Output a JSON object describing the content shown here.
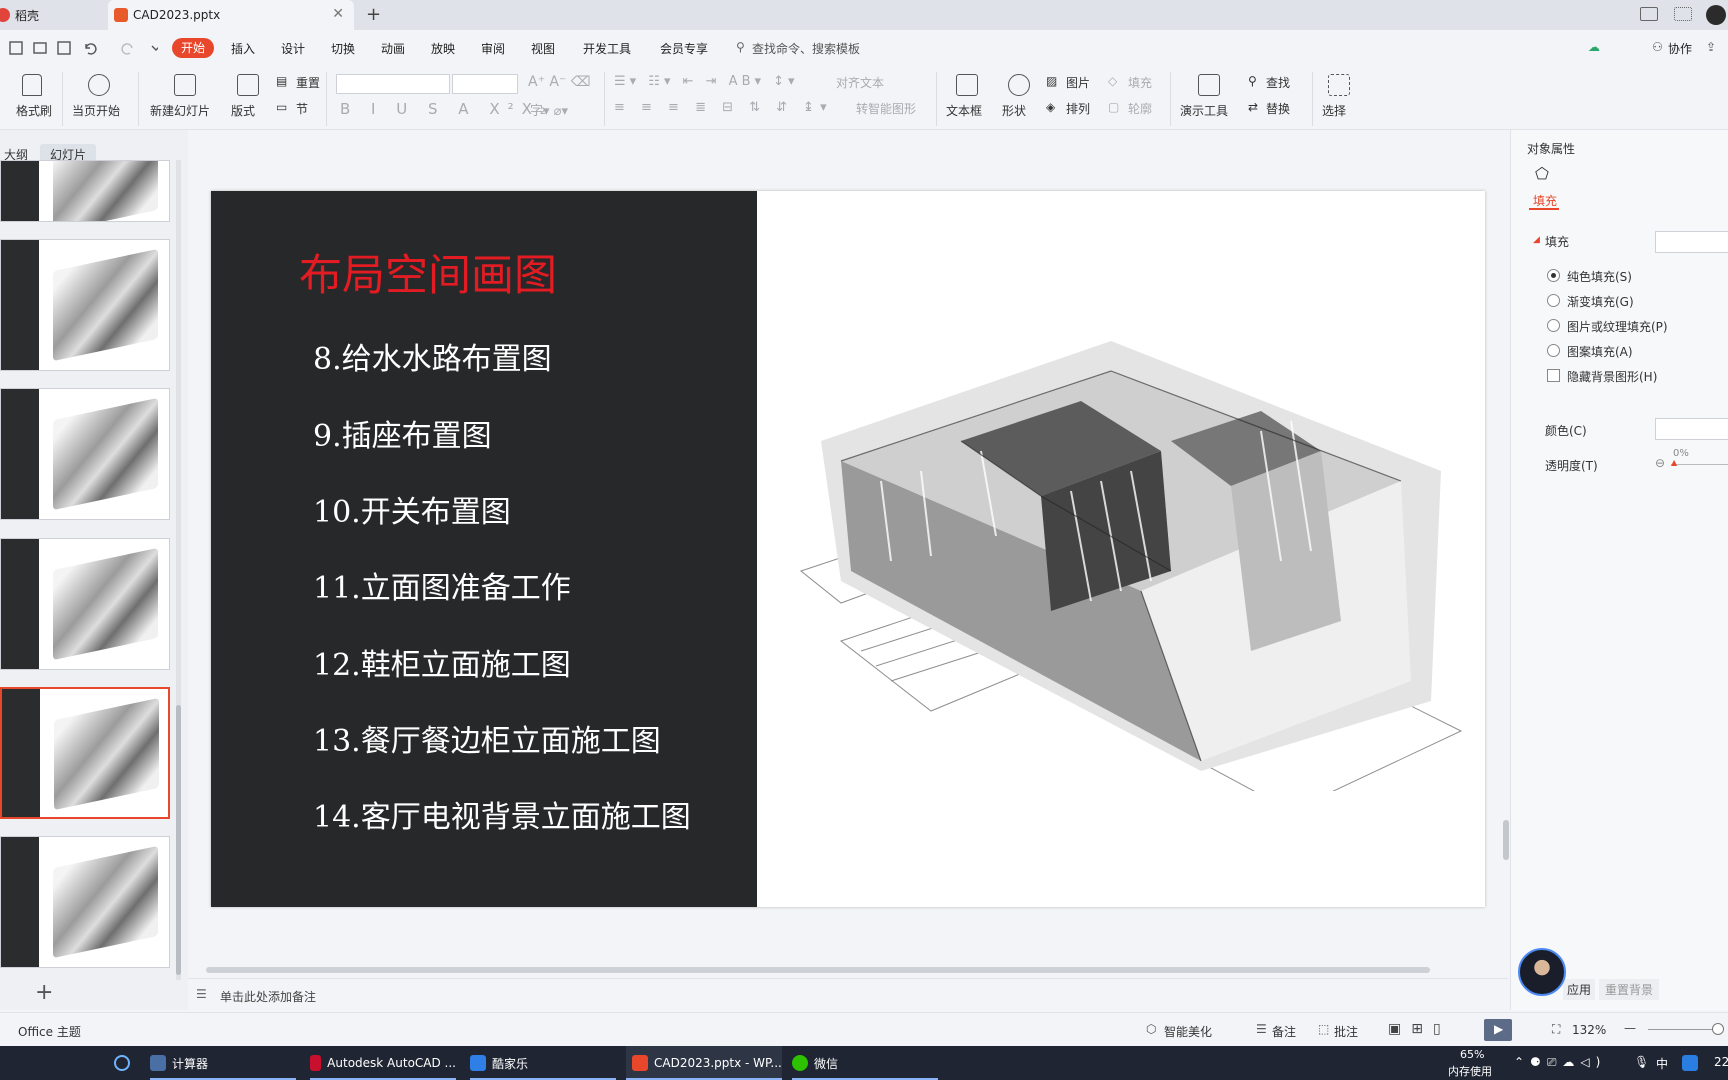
{
  "tabs": [
    {
      "label": "稻壳",
      "active": false
    },
    {
      "label": "CAD2023.pptx",
      "active": true
    }
  ],
  "menu": {
    "items": [
      "开始",
      "插入",
      "设计",
      "切换",
      "动画",
      "放映",
      "审阅",
      "视图",
      "开发工具",
      "会员专享"
    ],
    "search_placeholder": "查找命令、搜索模板",
    "collab": "协作"
  },
  "ribbon": {
    "format_painter": "格式刷",
    "from_current": "当页开始",
    "new_slide": "新建幻灯片",
    "layout": "版式",
    "reset": "重置",
    "section": "节",
    "align_text": "对齐文本",
    "to_smartart": "转智能图形",
    "textbox": "文本框",
    "shape": "形状",
    "picture": "图片",
    "fill": "填充",
    "arrange": "排列",
    "outline": "轮廓",
    "presentation_tools": "演示工具",
    "find": "查找",
    "replace": "替换",
    "select": "选择"
  },
  "left_pane": {
    "tabs": [
      "大纲",
      "幻灯片"
    ],
    "add_slide": "+"
  },
  "slide": {
    "title": "布局空间画图",
    "items": [
      "8.给水水路布置图",
      "9.插座布置图",
      "10.开关布置图",
      "11.立面图准备工作",
      "12.鞋柜立面施工图",
      "13.餐厅餐边柜立面施工图",
      "14.客厅电视背景立面施工图"
    ],
    "colors": {
      "panel": "#26282a",
      "title": "#e31b23",
      "text": "#ffffff"
    }
  },
  "notes_placeholder": "单击此处添加备注",
  "right_pane": {
    "header": "对象属性",
    "fill_tab": "填充",
    "section_fill": "填充",
    "options": [
      "纯色填充(S)",
      "渐变填充(G)",
      "图片或纹理填充(P)",
      "图案填充(A)"
    ],
    "hide_bg": "隐藏背景图形(H)",
    "color_label": "颜色(C)",
    "transparency_label": "透明度(T)",
    "transparency_value": "0%",
    "apply": "应用",
    "reset_bg": "重置背景"
  },
  "status": {
    "theme": "Office 主题",
    "beautify": "智能美化",
    "notes": "备注",
    "comments": "批注",
    "zoom": "132%"
  },
  "taskbar": {
    "apps": [
      "计算器",
      "Autodesk AutoCAD ...",
      "酷家乐",
      "CAD2023.pptx - WP...",
      "微信"
    ],
    "mem_percent": "65%",
    "mem_label": "内存使用",
    "ime": "中",
    "clock": "22"
  },
  "accent_color": "#e8472c"
}
